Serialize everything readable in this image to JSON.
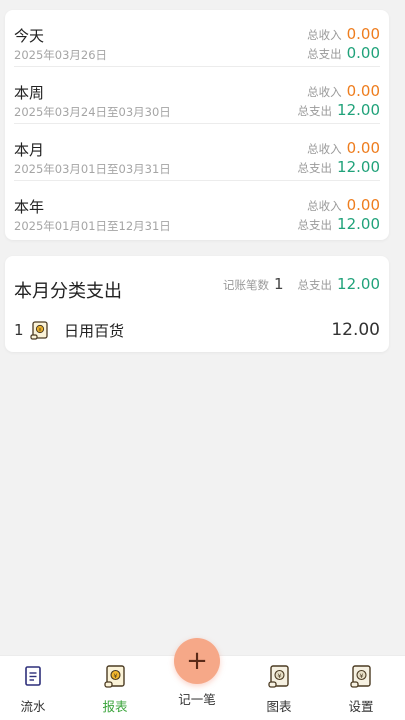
{
  "summary": {
    "rows": [
      {
        "title": "今天",
        "range": "2025年03月26日",
        "income_label": "总收入",
        "income": "0.00",
        "expense_label": "总支出",
        "expense": "0.00"
      },
      {
        "title": "本周",
        "range": "2025年03月24日至03月30日",
        "income_label": "总收入",
        "income": "0.00",
        "expense_label": "总支出",
        "expense": "12.00"
      },
      {
        "title": "本月",
        "range": "2025年03月01日至03月31日",
        "income_label": "总收入",
        "income": "0.00",
        "expense_label": "总支出",
        "expense": "12.00"
      },
      {
        "title": "本年",
        "range": "2025年01月01日至12月31日",
        "income_label": "总收入",
        "income": "0.00",
        "expense_label": "总支出",
        "expense": "12.00"
      }
    ]
  },
  "category": {
    "title": "本月分类支出",
    "count_label": "记账笔数",
    "count": "1",
    "total_label": "总支出",
    "total": "12.00",
    "items": [
      {
        "index": "1",
        "icon": "receipt-scroll-icon",
        "name": "日用百货",
        "amount": "12.00"
      }
    ]
  },
  "tabbar": {
    "tabs": [
      {
        "label": "流水",
        "icon": "list-icon",
        "active": false
      },
      {
        "label": "报表",
        "icon": "report-scroll-icon",
        "active": true
      },
      {
        "label": "记一笔",
        "icon": "plus-icon",
        "active": false
      },
      {
        "label": "图表",
        "icon": "chart-scroll-icon",
        "active": false
      },
      {
        "label": "设置",
        "icon": "settings-scroll-icon",
        "active": false
      }
    ]
  },
  "colors": {
    "income": "#ee7d1e",
    "expense": "#20a27a",
    "active_tab": "#3aa43b",
    "fab": "#f6a888"
  }
}
